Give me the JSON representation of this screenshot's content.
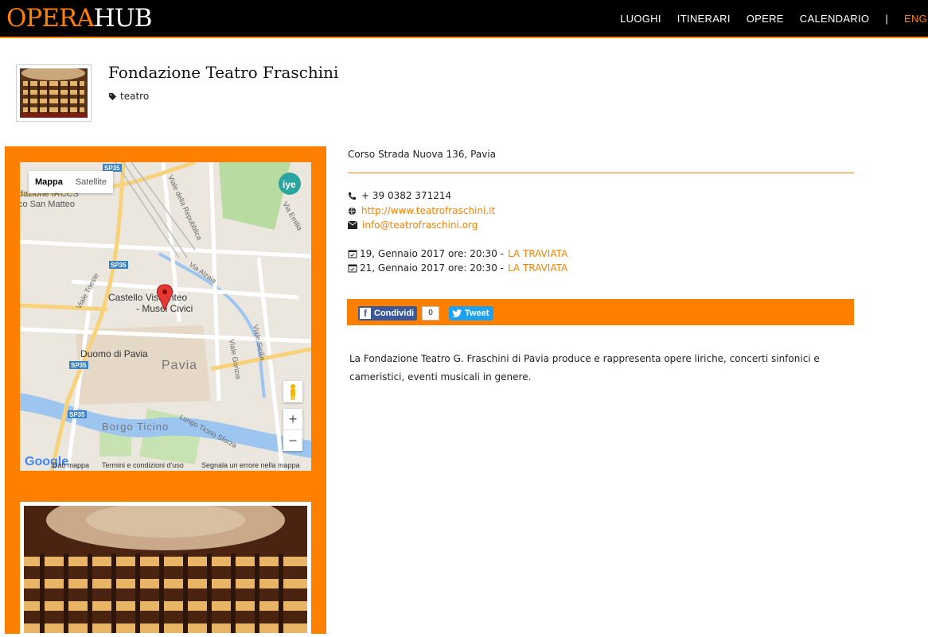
{
  "brand": {
    "part1": "OPERA",
    "part2": "HUB"
  },
  "nav": {
    "items": [
      "LUOGHI",
      "ITINERARI",
      "OPERE",
      "CALENDARIO"
    ],
    "separator": "|",
    "lang": "ENG"
  },
  "venue": {
    "title": "Fondazione Teatro Fraschini",
    "tag": "teatro"
  },
  "map": {
    "type_map": "Mappa",
    "type_satellite": "Satellite",
    "zoom_in": "+",
    "zoom_out": "−",
    "logo": "Google",
    "footer": {
      "data": "Dati mappa",
      "terms": "Termini e condizioni d'uso",
      "report": "Segnala un errore nella mappa"
    },
    "labels": {
      "castello1": "Castello Visconteo",
      "castello2": "- Musei Civici",
      "duomo": "Duomo di Pavia",
      "pavia": "Pavia",
      "borgo": "Borgo Ticino",
      "sanmatteo": "co San Matteo",
      "irccs": "dazione IRCCS",
      "repubblica": "Viale della Repubblica",
      "alzaia": "Via Alzaia",
      "gorizia": "Viale Gorizia",
      "sicilia": "Viale Sicilia",
      "emilia": "Via Emilia",
      "trieste": "Viale Trieste",
      "lungoticino": "Lungo Ticino Sforza",
      "sp35": "SP35",
      "badge": "iye"
    }
  },
  "contact": {
    "address": "Corso Strada Nuova 136, Pavia",
    "phone": "+ 39 0382 371214",
    "website": "http://www.teatrofraschini.it",
    "email": "info@teatrofraschini.org"
  },
  "events": [
    {
      "date": "19, Gennaio 2017 ore: 20:30 - ",
      "title": "LA TRAVIATA"
    },
    {
      "date": "21, Gennaio 2017 ore: 20:30 - ",
      "title": "LA TRAVIATA"
    }
  ],
  "share": {
    "facebook": "Condividi",
    "fb_count": "0",
    "twitter": "Tweet"
  },
  "description": "La Fondazione Teatro G. Fraschini di Pavia produce e rappresenta opere liriche, concerti sinfonici e cameristici, eventi musicali in genere.",
  "colors": {
    "accent": "#ff8000",
    "topbar": "#000000",
    "facebook": "#3b5998",
    "twitter": "#1da1f2"
  }
}
